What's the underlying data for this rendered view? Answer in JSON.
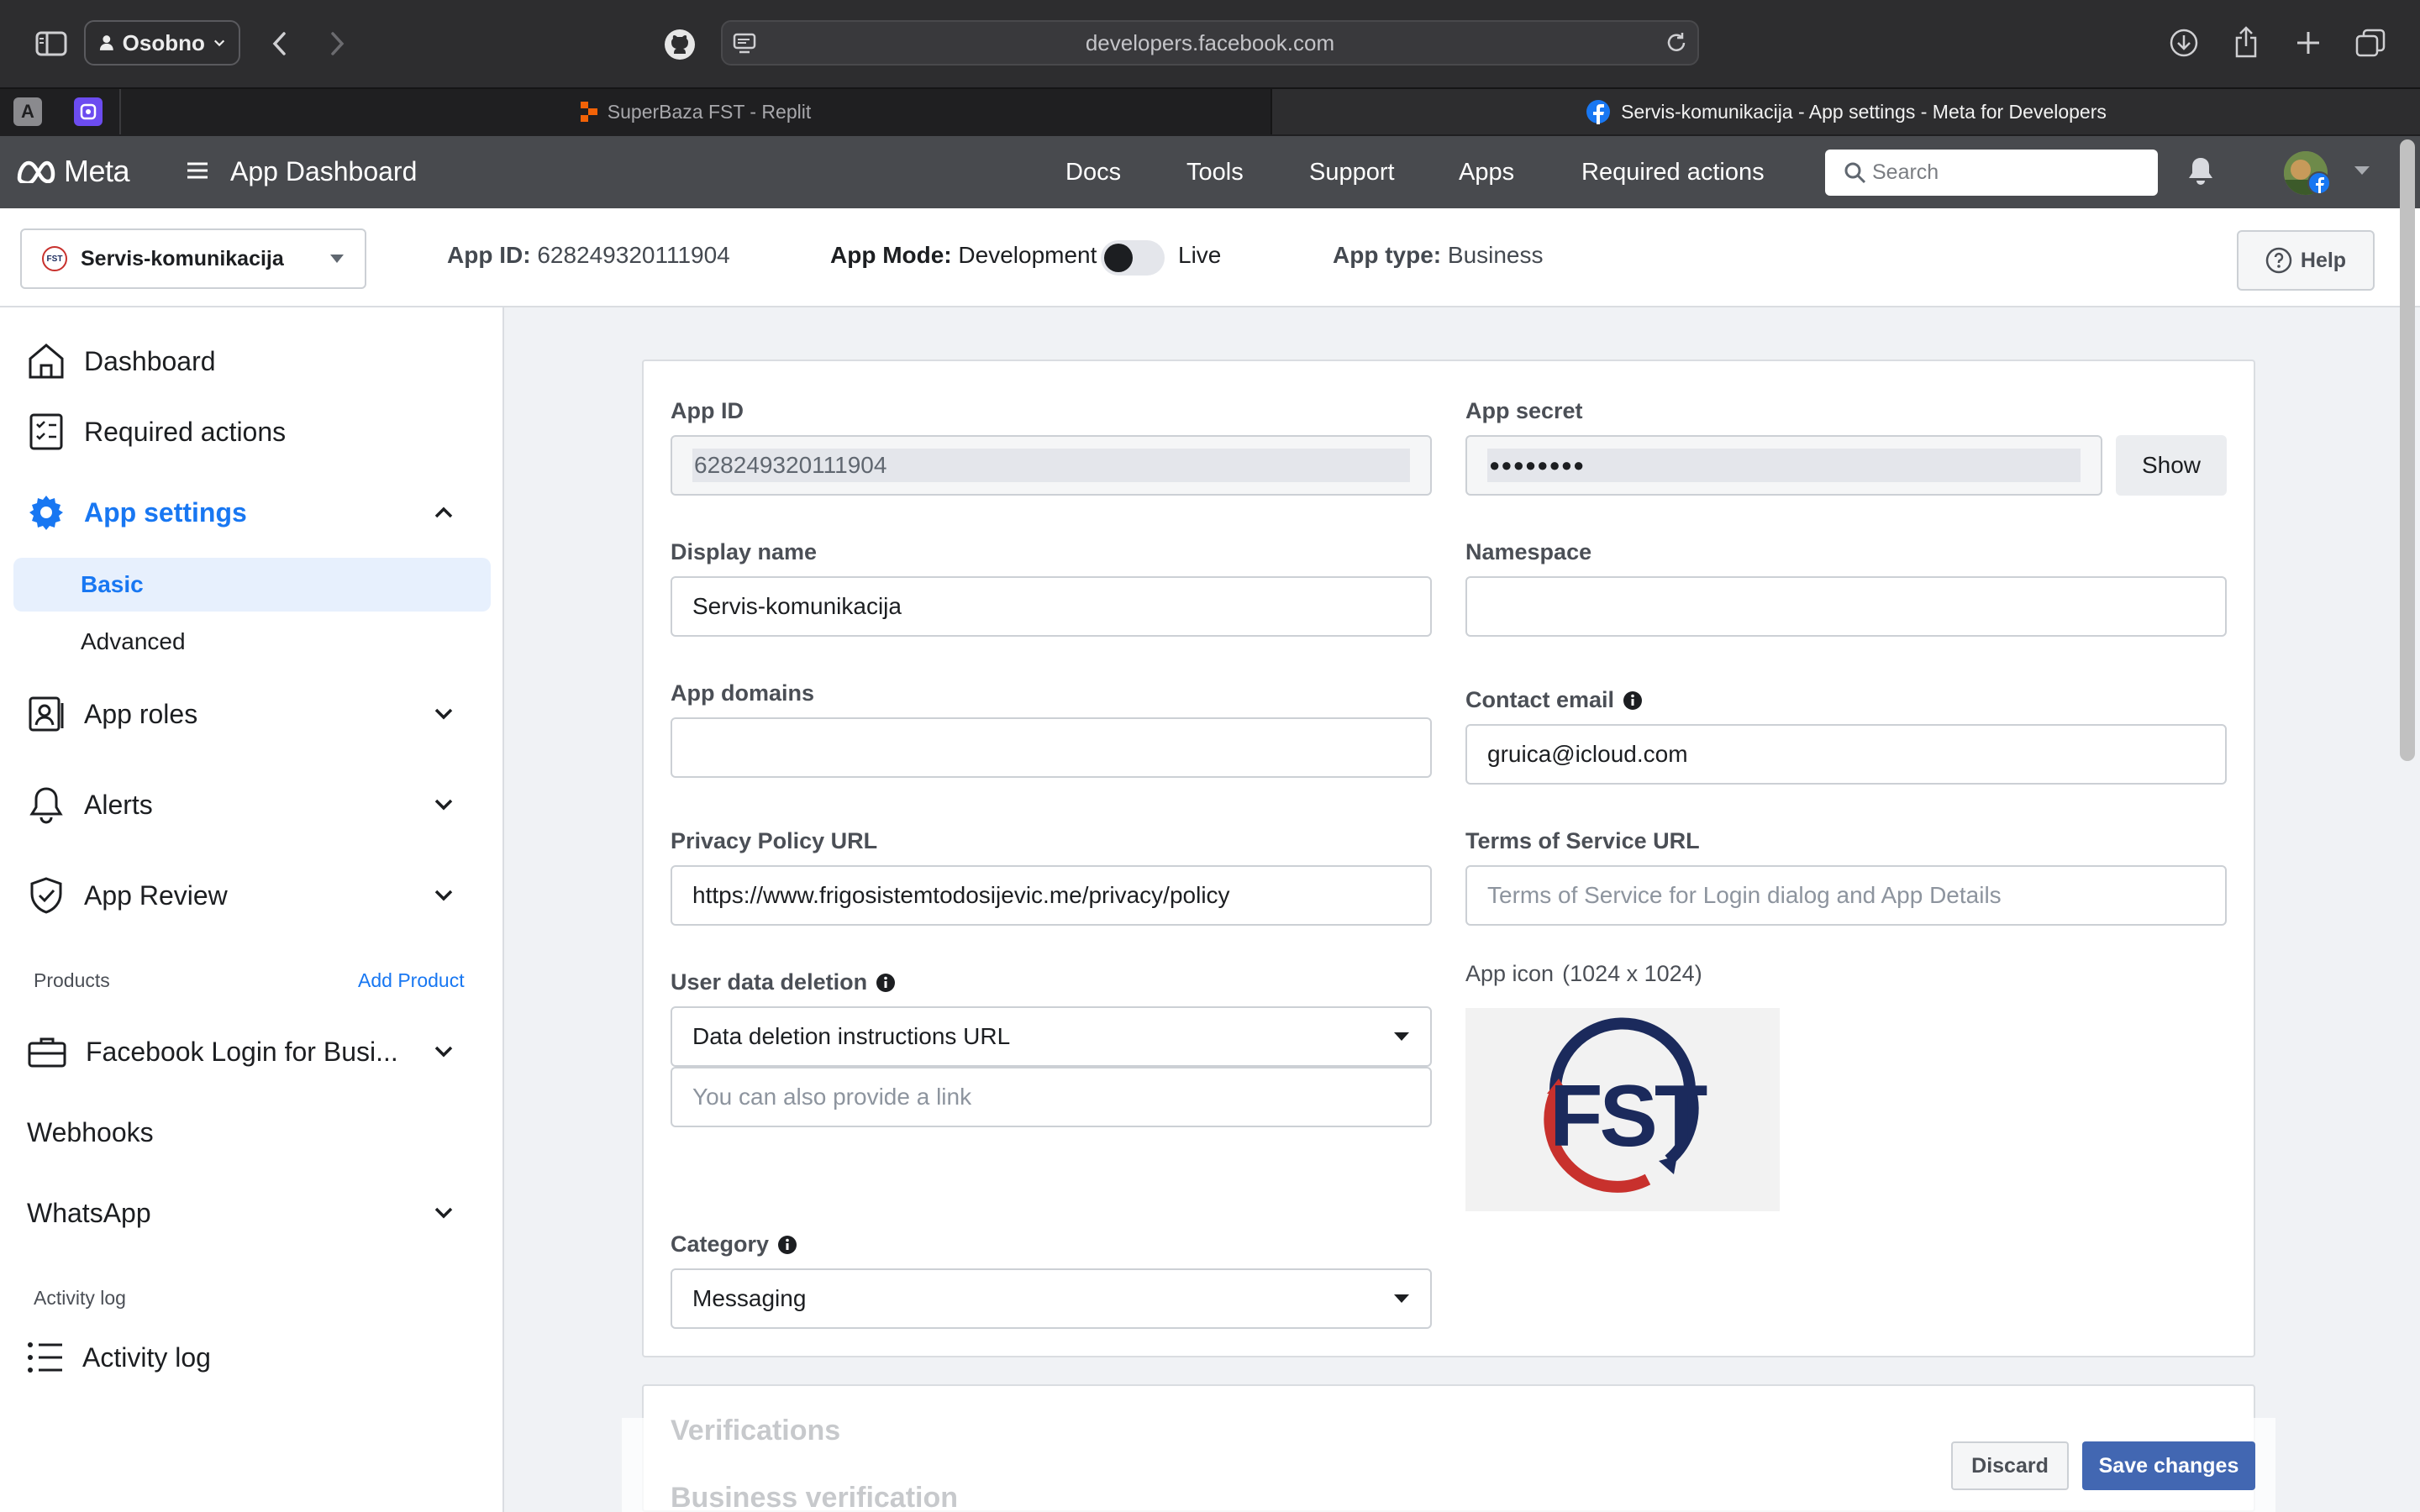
{
  "browser": {
    "profile_label": "Osobno",
    "url": "developers.facebook.com",
    "tabs": [
      {
        "title": "SuperBaza FST - Replit",
        "active": false
      },
      {
        "title": "Servis-komunikacija - App settings - Meta for Developers",
        "active": true
      }
    ],
    "pinned_tabs": [
      {
        "letter": "A"
      }
    ]
  },
  "nav": {
    "brand": "Meta",
    "dashboard_label": "App Dashboard",
    "links": [
      "Docs",
      "Tools",
      "Support",
      "Apps",
      "Required actions"
    ],
    "search_placeholder": "Search"
  },
  "app_bar": {
    "app_name": "Servis-komunikacija",
    "app_logo_text": "FST",
    "app_id_label": "App ID:",
    "app_id_value": "628249320111904",
    "app_mode_label": "App Mode:",
    "app_mode_value": "Development",
    "live_label": "Live",
    "live_enabled": false,
    "app_type_label": "App type:",
    "app_type_value": "Business",
    "help_label": "Help"
  },
  "sidebar": {
    "dashboard": "Dashboard",
    "required_actions": "Required actions",
    "app_settings": "App settings",
    "basic": "Basic",
    "advanced": "Advanced",
    "app_roles": "App roles",
    "alerts": "Alerts",
    "app_review": "App Review",
    "products_label": "Products",
    "add_product": "Add Product",
    "facebook_login": "Facebook Login for Busi...",
    "webhooks": "Webhooks",
    "whatsapp": "WhatsApp",
    "activity_log_section": "Activity log",
    "activity_log": "Activity log"
  },
  "form": {
    "app_id_label": "App ID",
    "app_id_value": "628249320111904",
    "app_secret_label": "App secret",
    "app_secret_value": "●●●●●●●●",
    "show_label": "Show",
    "display_name_label": "Display name",
    "display_name_value": "Servis-komunikacija",
    "namespace_label": "Namespace",
    "namespace_value": "",
    "app_domains_label": "App domains",
    "app_domains_value": "",
    "contact_email_label": "Contact email",
    "contact_email_value": "gruica@icloud.com",
    "privacy_label": "Privacy Policy URL",
    "privacy_value": "https://www.frigosistemtodosijevic.me/privacy/policy",
    "tos_label": "Terms of Service URL",
    "tos_placeholder": "Terms of Service for Login dialog and App Details",
    "user_data_label": "User data deletion",
    "user_data_value": "Data deletion instructions URL",
    "user_data_link_placeholder": "You can also provide a link",
    "app_icon_label": "App icon",
    "app_icon_size": "(1024 x 1024)",
    "app_icon_text": "FST",
    "category_label": "Category",
    "category_value": "Messaging"
  },
  "footer": {
    "verifications": "Verifications",
    "business_verification": "Business verification",
    "discard": "Discard",
    "save": "Save changes"
  },
  "colors": {
    "accent": "#1877f2",
    "nav_bg": "#484a4e",
    "save_button": "#4267b2",
    "logo_red": "#c8312d",
    "logo_navy": "#1b2a5c"
  }
}
